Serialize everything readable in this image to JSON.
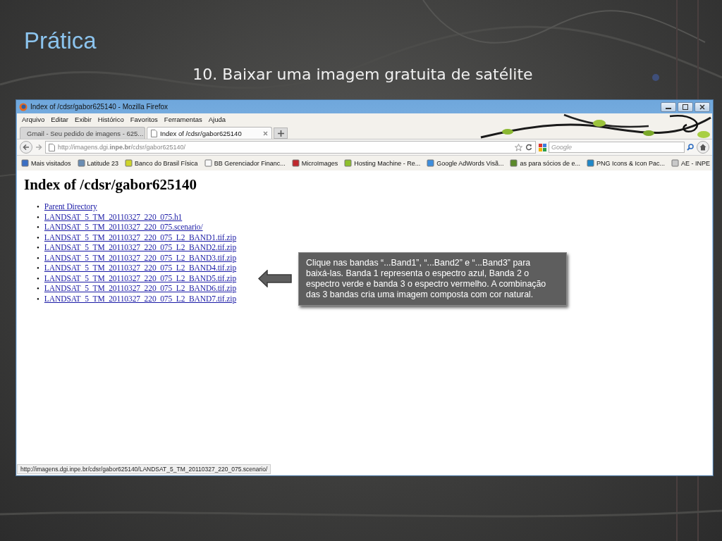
{
  "slide": {
    "title": "Prática",
    "subtitle": "10. Baixar uma imagem gratuita de satélite"
  },
  "browser": {
    "window_title": "Index of /cdsr/gabor625140 - Mozilla Firefox",
    "menu": [
      "Arquivo",
      "Editar",
      "Exibir",
      "Histórico",
      "Favoritos",
      "Ferramentas",
      "Ajuda"
    ],
    "tabs": [
      {
        "label": "Gmail - Seu pedido de imagens - 625...",
        "selected": false,
        "kind": "mail"
      },
      {
        "label": "Index of /cdsr/gabor625140",
        "selected": true,
        "kind": "page"
      }
    ],
    "address": "http://imagens.dgi.**inpe.br**/cdsr/gabor625140/",
    "search": {
      "placeholder": "Google"
    },
    "bookmarks": [
      "Mais visitados",
      "Latitude 23",
      "Banco do Brasil Física",
      "BB Gerenciador Financ...",
      "MicroImages",
      "Hosting Machine - Re...",
      "Google AdWords Visã...",
      "as para sócios de e...",
      "PNG Icons & Icon Pac...",
      "AE - INPE"
    ],
    "page": {
      "heading": "Index of /cdsr/gabor625140",
      "links": [
        {
          "bullet": "•",
          "label": "Parent Directory"
        },
        {
          "bullet": "•",
          "label": "LANDSAT_5_TM_20110327_220_075.h1"
        },
        {
          "bullet": "•",
          "label": "LANDSAT_5_TM_20110327_220_075.scenario/"
        },
        {
          "bullet": "•",
          "label": "LANDSAT_5_TM_20110327_220_075_L2_BAND1.tif.zip"
        },
        {
          "bullet": "•",
          "label": "LANDSAT_5_TM_20110327_220_075_L2_BAND2.tif.zip"
        },
        {
          "bullet": "•",
          "label": "LANDSAT_5_TM_20110327_220_075_L2_BAND3.tif.zip"
        },
        {
          "bullet": "•",
          "label": "LANDSAT_5_TM_20110327_220_075_L2_BAND4.tif.zip"
        },
        {
          "bullet": "•",
          "label": "LANDSAT_5_TM_20110327_220_075_L2_BAND5.tif.zip"
        },
        {
          "bullet": "•",
          "label": "LANDSAT_5_TM_20110327_220_075_L2_BAND6.tif.zip"
        },
        {
          "bullet": "•",
          "label": "LANDSAT_5_TM_20110327_220_075_L2_BAND7.tif.zip"
        }
      ]
    },
    "status_bar": "http://imagens.dgi.inpe.br/cdsr/gabor625140/LANDSAT_5_TM_20110327_220_075.scenario/"
  },
  "callout": {
    "text": "Clique nas bandas “...Band1”, “...Band2” e “...Band3” para baixá-las. Banda 1 representa o espectro azul, Banda 2 o espectro verde e banda 3 o espectro vermelho. A combinação das 3 bandas cria uma imagem composta com cor natural."
  }
}
